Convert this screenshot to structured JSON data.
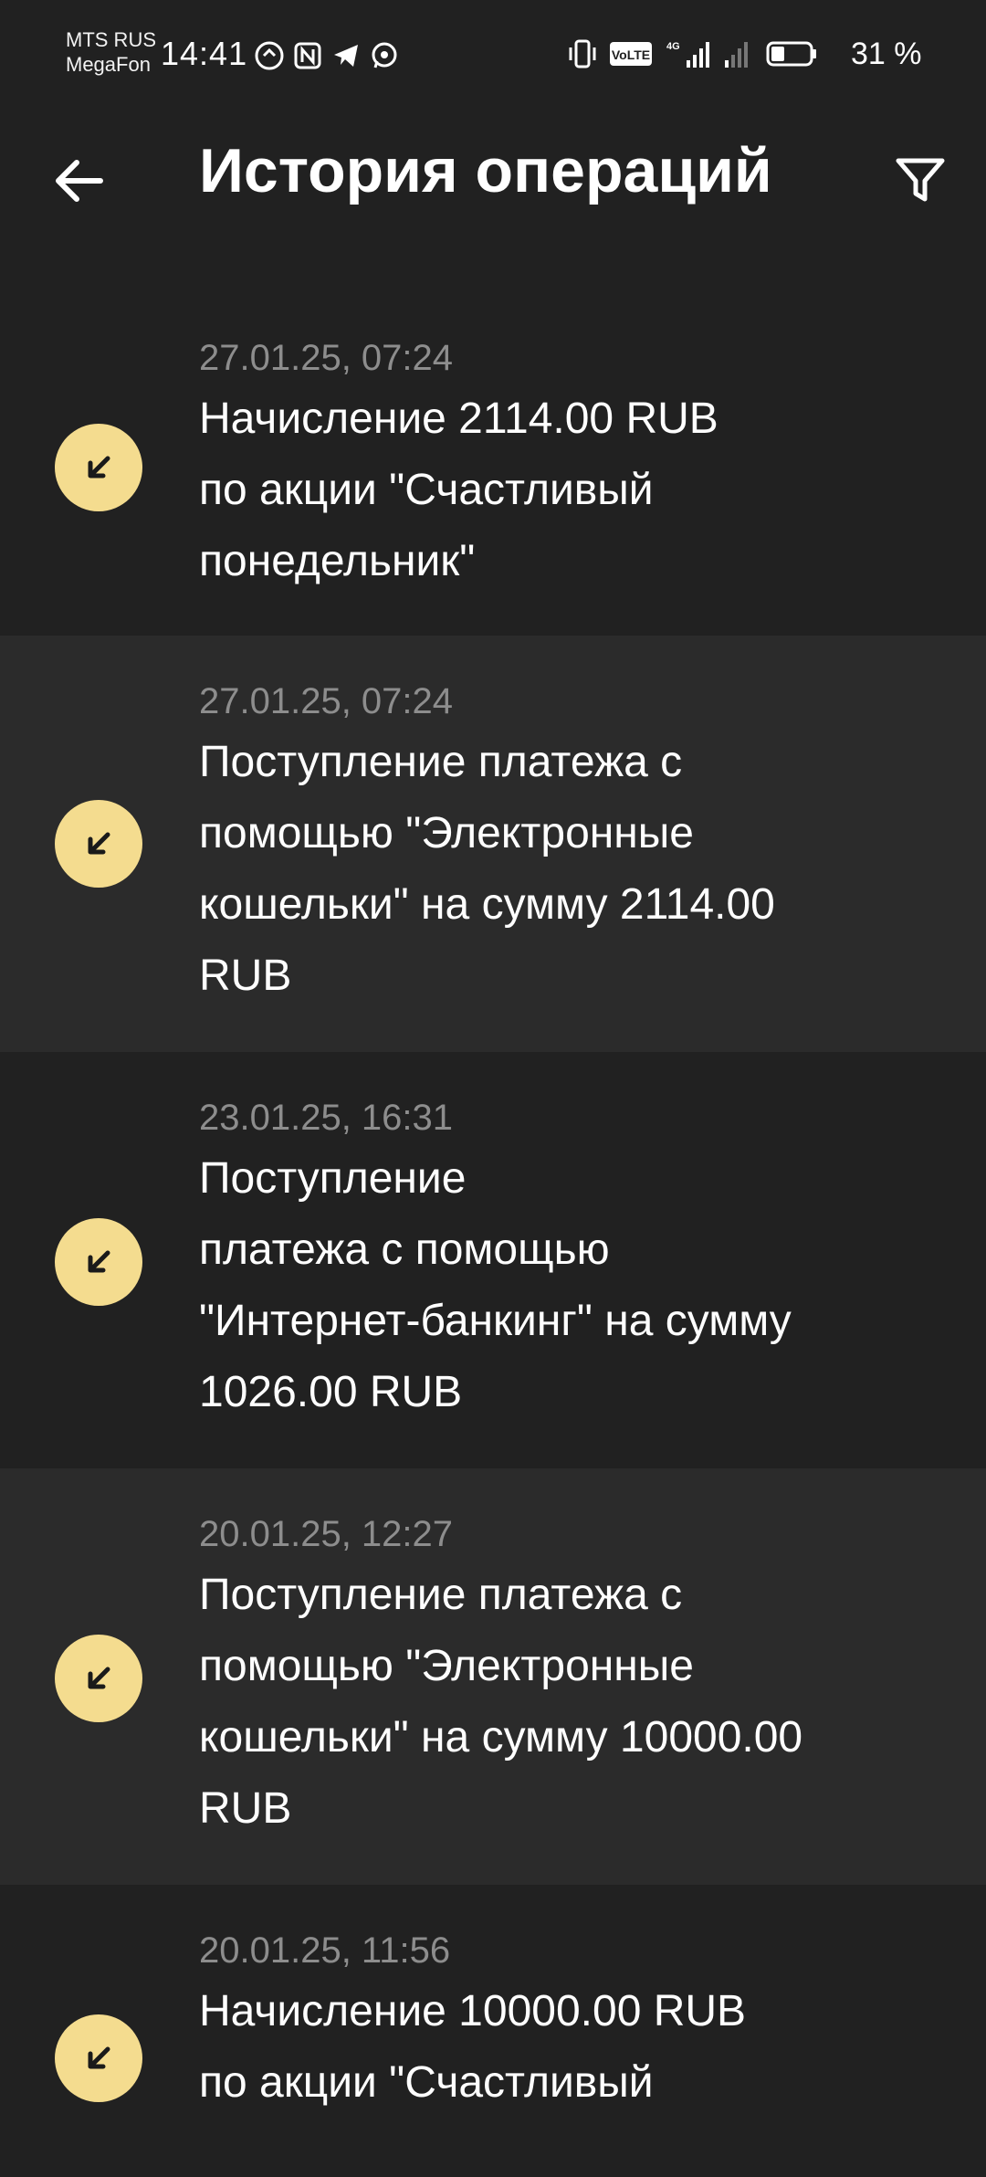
{
  "status_bar": {
    "carrier_1": "MTS RUS",
    "carrier_2": "MegaFon",
    "time": "14:41",
    "battery": "31 %"
  },
  "header": {
    "title": "История операций"
  },
  "transactions": [
    {
      "date": "27.01.25, 07:24",
      "lines": [
        "Начисление 2114.00 RUB",
        "по акции \"Счастливый",
        "понедельник\""
      ]
    },
    {
      "date": "27.01.25, 07:24",
      "lines": [
        "Поступление платежа с",
        "помощью \"Электронные",
        "кошельки\" на сумму 2114.00",
        "RUB"
      ]
    },
    {
      "date": "23.01.25, 16:31",
      "lines": [
        "Поступление",
        "платежа с помощью",
        "\"Интернет-банкинг\" на сумму",
        "1026.00 RUB"
      ]
    },
    {
      "date": "20.01.25, 12:27",
      "lines": [
        "Поступление платежа с",
        "помощью \"Электронные",
        "кошельки\" на сумму 10000.00",
        "RUB"
      ]
    },
    {
      "date": "20.01.25, 11:56",
      "lines": [
        "Начисление 10000.00 RUB",
        "по акции \"Счастливый"
      ]
    }
  ],
  "colors": {
    "background": "#212121",
    "alt_row": "#2b2b2b",
    "icon_bg": "#f4dc8f",
    "date_text": "#8d8d8d"
  }
}
